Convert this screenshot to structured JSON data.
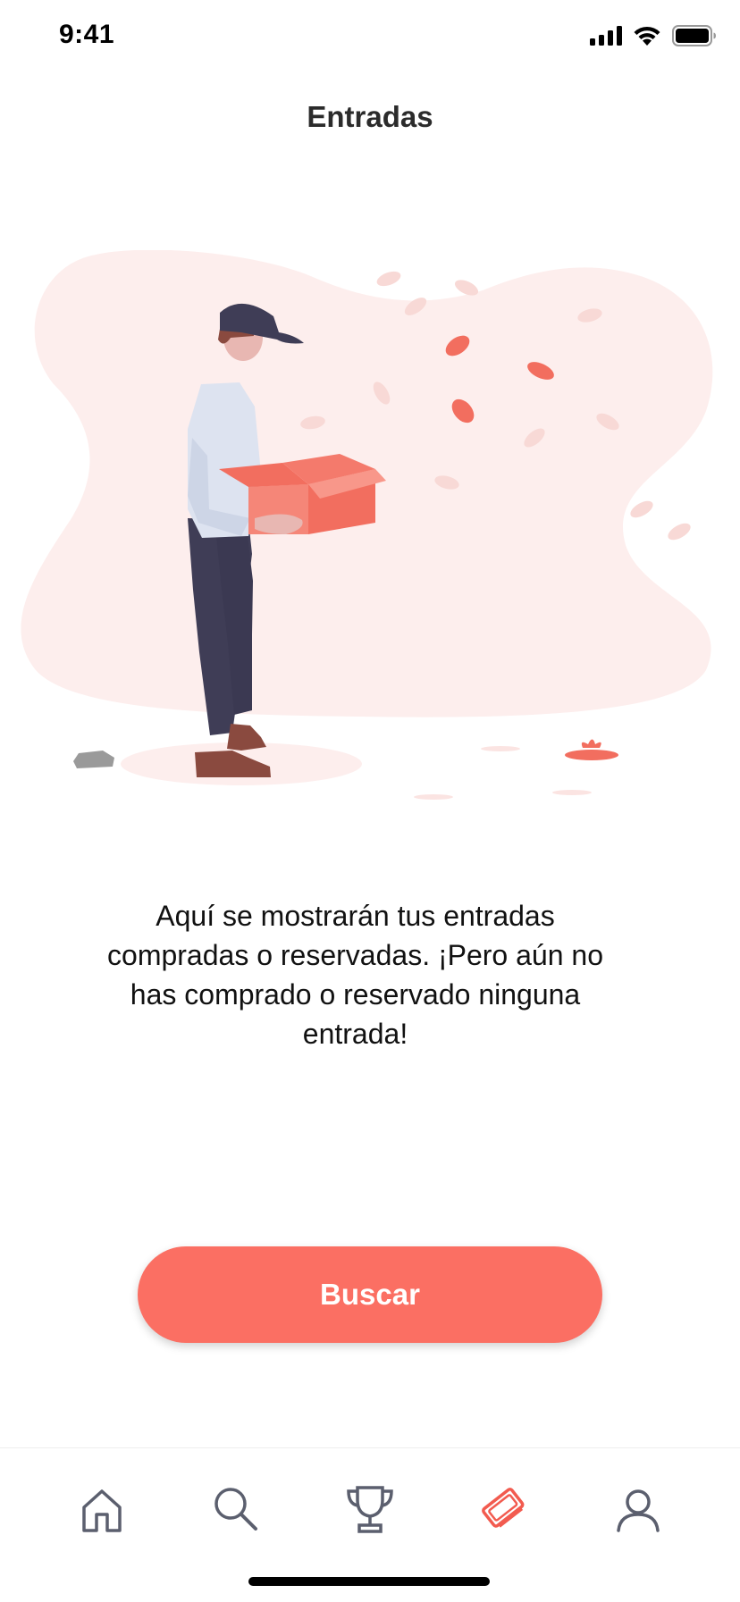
{
  "status_bar": {
    "time": "9:41"
  },
  "header": {
    "title": "Entradas"
  },
  "illustration": {
    "icon": "empty-box-illustration",
    "accent_color": "#f26e5f",
    "blob_color": "#fdeeed"
  },
  "empty_state": {
    "message": "Aquí se mostrarán tus entradas compradas o reservadas. ¡Pero aún no has comprado o reservado ninguna entrada!"
  },
  "actions": {
    "search_label": "Buscar",
    "search_color": "#fb6f63"
  },
  "tab_bar": {
    "items": [
      {
        "icon": "home-icon",
        "active": false
      },
      {
        "icon": "search-icon",
        "active": false
      },
      {
        "icon": "trophy-icon",
        "active": false
      },
      {
        "icon": "tickets-icon",
        "active": true
      },
      {
        "icon": "profile-icon",
        "active": false
      }
    ],
    "active_color": "#f25b4f",
    "inactive_color": "#5b5f6e"
  }
}
